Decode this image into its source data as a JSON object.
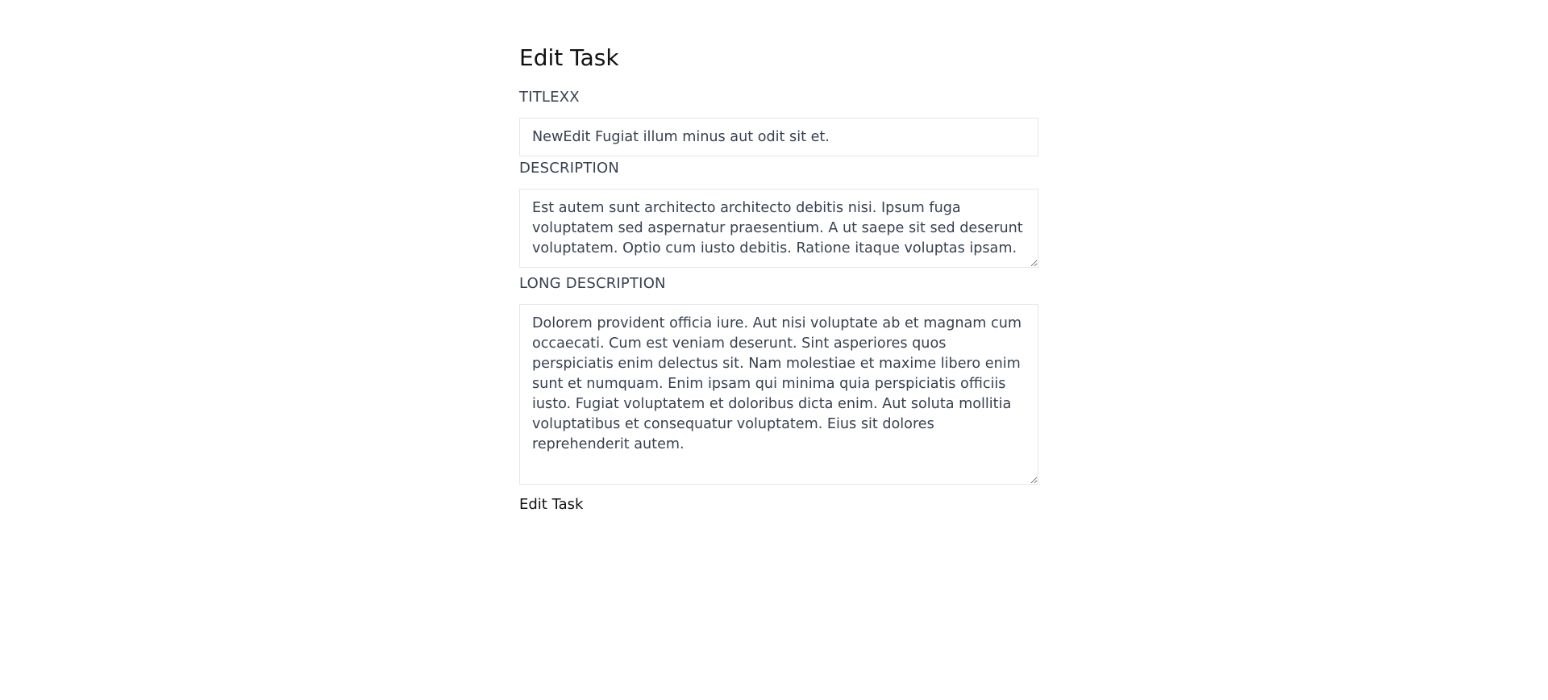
{
  "page": {
    "heading": "Edit Task"
  },
  "form": {
    "title_label": "TITLEXX",
    "title_value": "NewEdit Fugiat illum minus aut odit sit et.",
    "description_label": "DESCRIPTION",
    "description_value": "Est autem sunt architecto architecto debitis nisi. Ipsum fuga voluptatem sed aspernatur praesentium. A ut saepe sit sed deserunt voluptatem. Optio cum iusto debitis. Ratione itaque voluptas ipsam.",
    "long_description_label": "LONG DESCRIPTION",
    "long_description_value": "Dolorem provident officia iure. Aut nisi voluptate ab et magnam cum occaecati. Cum est veniam deserunt. Sint asperiores quos perspiciatis enim delectus sit. Nam molestiae et maxime libero enim sunt et numquam. Enim ipsam qui minima quia perspiciatis officiis iusto. Fugiat voluptatem et doloribus dicta enim. Aut soluta mollitia voluptatibus et consequatur voluptatem. Eius sit dolores reprehenderit autem.",
    "submit_label": "Edit Task"
  }
}
